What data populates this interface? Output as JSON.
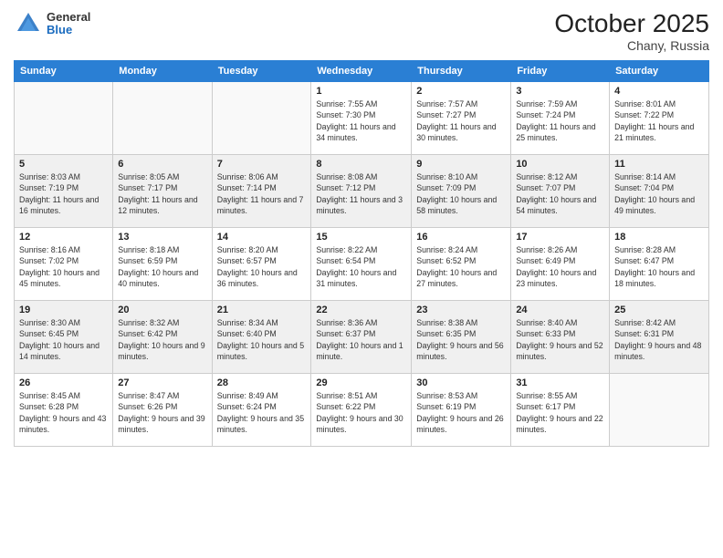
{
  "header": {
    "logo_general": "General",
    "logo_blue": "Blue",
    "month_year": "October 2025",
    "location": "Chany, Russia"
  },
  "weekdays": [
    "Sunday",
    "Monday",
    "Tuesday",
    "Wednesday",
    "Thursday",
    "Friday",
    "Saturday"
  ],
  "weeks": [
    [
      {
        "day": "",
        "sunrise": "",
        "sunset": "",
        "daylight": ""
      },
      {
        "day": "",
        "sunrise": "",
        "sunset": "",
        "daylight": ""
      },
      {
        "day": "",
        "sunrise": "",
        "sunset": "",
        "daylight": ""
      },
      {
        "day": "1",
        "sunrise": "Sunrise: 7:55 AM",
        "sunset": "Sunset: 7:30 PM",
        "daylight": "Daylight: 11 hours and 34 minutes."
      },
      {
        "day": "2",
        "sunrise": "Sunrise: 7:57 AM",
        "sunset": "Sunset: 7:27 PM",
        "daylight": "Daylight: 11 hours and 30 minutes."
      },
      {
        "day": "3",
        "sunrise": "Sunrise: 7:59 AM",
        "sunset": "Sunset: 7:24 PM",
        "daylight": "Daylight: 11 hours and 25 minutes."
      },
      {
        "day": "4",
        "sunrise": "Sunrise: 8:01 AM",
        "sunset": "Sunset: 7:22 PM",
        "daylight": "Daylight: 11 hours and 21 minutes."
      }
    ],
    [
      {
        "day": "5",
        "sunrise": "Sunrise: 8:03 AM",
        "sunset": "Sunset: 7:19 PM",
        "daylight": "Daylight: 11 hours and 16 minutes."
      },
      {
        "day": "6",
        "sunrise": "Sunrise: 8:05 AM",
        "sunset": "Sunset: 7:17 PM",
        "daylight": "Daylight: 11 hours and 12 minutes."
      },
      {
        "day": "7",
        "sunrise": "Sunrise: 8:06 AM",
        "sunset": "Sunset: 7:14 PM",
        "daylight": "Daylight: 11 hours and 7 minutes."
      },
      {
        "day": "8",
        "sunrise": "Sunrise: 8:08 AM",
        "sunset": "Sunset: 7:12 PM",
        "daylight": "Daylight: 11 hours and 3 minutes."
      },
      {
        "day": "9",
        "sunrise": "Sunrise: 8:10 AM",
        "sunset": "Sunset: 7:09 PM",
        "daylight": "Daylight: 10 hours and 58 minutes."
      },
      {
        "day": "10",
        "sunrise": "Sunrise: 8:12 AM",
        "sunset": "Sunset: 7:07 PM",
        "daylight": "Daylight: 10 hours and 54 minutes."
      },
      {
        "day": "11",
        "sunrise": "Sunrise: 8:14 AM",
        "sunset": "Sunset: 7:04 PM",
        "daylight": "Daylight: 10 hours and 49 minutes."
      }
    ],
    [
      {
        "day": "12",
        "sunrise": "Sunrise: 8:16 AM",
        "sunset": "Sunset: 7:02 PM",
        "daylight": "Daylight: 10 hours and 45 minutes."
      },
      {
        "day": "13",
        "sunrise": "Sunrise: 8:18 AM",
        "sunset": "Sunset: 6:59 PM",
        "daylight": "Daylight: 10 hours and 40 minutes."
      },
      {
        "day": "14",
        "sunrise": "Sunrise: 8:20 AM",
        "sunset": "Sunset: 6:57 PM",
        "daylight": "Daylight: 10 hours and 36 minutes."
      },
      {
        "day": "15",
        "sunrise": "Sunrise: 8:22 AM",
        "sunset": "Sunset: 6:54 PM",
        "daylight": "Daylight: 10 hours and 31 minutes."
      },
      {
        "day": "16",
        "sunrise": "Sunrise: 8:24 AM",
        "sunset": "Sunset: 6:52 PM",
        "daylight": "Daylight: 10 hours and 27 minutes."
      },
      {
        "day": "17",
        "sunrise": "Sunrise: 8:26 AM",
        "sunset": "Sunset: 6:49 PM",
        "daylight": "Daylight: 10 hours and 23 minutes."
      },
      {
        "day": "18",
        "sunrise": "Sunrise: 8:28 AM",
        "sunset": "Sunset: 6:47 PM",
        "daylight": "Daylight: 10 hours and 18 minutes."
      }
    ],
    [
      {
        "day": "19",
        "sunrise": "Sunrise: 8:30 AM",
        "sunset": "Sunset: 6:45 PM",
        "daylight": "Daylight: 10 hours and 14 minutes."
      },
      {
        "day": "20",
        "sunrise": "Sunrise: 8:32 AM",
        "sunset": "Sunset: 6:42 PM",
        "daylight": "Daylight: 10 hours and 9 minutes."
      },
      {
        "day": "21",
        "sunrise": "Sunrise: 8:34 AM",
        "sunset": "Sunset: 6:40 PM",
        "daylight": "Daylight: 10 hours and 5 minutes."
      },
      {
        "day": "22",
        "sunrise": "Sunrise: 8:36 AM",
        "sunset": "Sunset: 6:37 PM",
        "daylight": "Daylight: 10 hours and 1 minute."
      },
      {
        "day": "23",
        "sunrise": "Sunrise: 8:38 AM",
        "sunset": "Sunset: 6:35 PM",
        "daylight": "Daylight: 9 hours and 56 minutes."
      },
      {
        "day": "24",
        "sunrise": "Sunrise: 8:40 AM",
        "sunset": "Sunset: 6:33 PM",
        "daylight": "Daylight: 9 hours and 52 minutes."
      },
      {
        "day": "25",
        "sunrise": "Sunrise: 8:42 AM",
        "sunset": "Sunset: 6:31 PM",
        "daylight": "Daylight: 9 hours and 48 minutes."
      }
    ],
    [
      {
        "day": "26",
        "sunrise": "Sunrise: 8:45 AM",
        "sunset": "Sunset: 6:28 PM",
        "daylight": "Daylight: 9 hours and 43 minutes."
      },
      {
        "day": "27",
        "sunrise": "Sunrise: 8:47 AM",
        "sunset": "Sunset: 6:26 PM",
        "daylight": "Daylight: 9 hours and 39 minutes."
      },
      {
        "day": "28",
        "sunrise": "Sunrise: 8:49 AM",
        "sunset": "Sunset: 6:24 PM",
        "daylight": "Daylight: 9 hours and 35 minutes."
      },
      {
        "day": "29",
        "sunrise": "Sunrise: 8:51 AM",
        "sunset": "Sunset: 6:22 PM",
        "daylight": "Daylight: 9 hours and 30 minutes."
      },
      {
        "day": "30",
        "sunrise": "Sunrise: 8:53 AM",
        "sunset": "Sunset: 6:19 PM",
        "daylight": "Daylight: 9 hours and 26 minutes."
      },
      {
        "day": "31",
        "sunrise": "Sunrise: 8:55 AM",
        "sunset": "Sunset: 6:17 PM",
        "daylight": "Daylight: 9 hours and 22 minutes."
      },
      {
        "day": "",
        "sunrise": "",
        "sunset": "",
        "daylight": ""
      }
    ]
  ]
}
